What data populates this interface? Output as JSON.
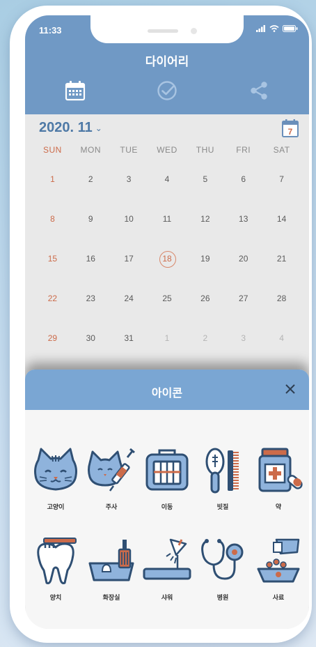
{
  "status_bar": {
    "time": "11:33"
  },
  "header": {
    "title": "다이어리"
  },
  "toolbar": [
    "calendar-icon",
    "check-icon",
    "share-icon"
  ],
  "calendar": {
    "month_label": "2020. 11",
    "today_icon_day": "7",
    "weekdays": [
      "SUN",
      "MON",
      "TUE",
      "WED",
      "THU",
      "FRI",
      "SAT"
    ],
    "weeks": [
      [
        "1",
        "2",
        "3",
        "4",
        "5",
        "6",
        "7"
      ],
      [
        "8",
        "9",
        "10",
        "11",
        "12",
        "13",
        "14"
      ],
      [
        "15",
        "16",
        "17",
        "18",
        "19",
        "20",
        "21"
      ],
      [
        "22",
        "23",
        "24",
        "25",
        "26",
        "27",
        "28"
      ],
      [
        "29",
        "30",
        "31",
        "1",
        "2",
        "3",
        "4"
      ]
    ],
    "selected_day": "18"
  },
  "sheet": {
    "title": "아이콘",
    "close_label": "✕",
    "icons": [
      {
        "label": "고양이",
        "icon": "cat-icon"
      },
      {
        "label": "주사",
        "icon": "syringe-icon"
      },
      {
        "label": "이동",
        "icon": "carrier-icon"
      },
      {
        "label": "빗질",
        "icon": "brush-icon"
      },
      {
        "label": "약",
        "icon": "medicine-icon"
      },
      {
        "label": "양치",
        "icon": "tooth-icon"
      },
      {
        "label": "화장실",
        "icon": "litter-box-icon"
      },
      {
        "label": "샤워",
        "icon": "shower-icon"
      },
      {
        "label": "병원",
        "icon": "stethoscope-icon"
      },
      {
        "label": "사료",
        "icon": "food-bowl-icon"
      }
    ]
  },
  "colors": {
    "header": "#7099c5",
    "sheet_header": "#7aa6d3",
    "accent": "#cc6b4a",
    "icon_stroke": "#2f4f73",
    "icon_fill": "#8fb3dc"
  }
}
